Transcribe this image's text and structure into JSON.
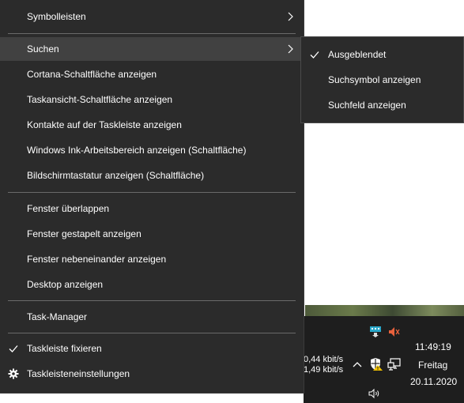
{
  "menu": {
    "items": [
      {
        "label": "Symbolleisten"
      },
      {
        "label": "Suchen"
      },
      {
        "label": "Cortana-Schaltfläche anzeigen"
      },
      {
        "label": "Taskansicht-Schaltfläche anzeigen"
      },
      {
        "label": "Kontakte auf der Taskleiste anzeigen"
      },
      {
        "label": "Windows Ink-Arbeitsbereich anzeigen (Schaltfläche)"
      },
      {
        "label": "Bildschirmtastatur anzeigen (Schaltfläche)"
      },
      {
        "label": "Fenster überlappen"
      },
      {
        "label": "Fenster gestapelt anzeigen"
      },
      {
        "label": "Fenster nebeneinander anzeigen"
      },
      {
        "label": "Desktop anzeigen"
      },
      {
        "label": "Task-Manager"
      },
      {
        "label": "Taskleiste fixieren"
      },
      {
        "label": "Taskleisteneinstellungen"
      }
    ]
  },
  "submenu": {
    "items": [
      {
        "label": "Ausgeblendet"
      },
      {
        "label": "Suchsymbol anzeigen"
      },
      {
        "label": "Suchfeld anzeigen"
      }
    ]
  },
  "tray": {
    "upload": "0,44 kbit/s",
    "download": "1,49 kbit/s",
    "time": "11:49:19",
    "weekday": "Freitag",
    "date": "20.11.2020"
  },
  "colors": {
    "menu_bg": "#2b2b2b",
    "hover_bg": "#414141",
    "separator": "#6a6a6a",
    "taskbar_bg": "#1e1e1e",
    "text": "#ffffff"
  },
  "icons": {
    "chevron": "chevron-right-icon",
    "check": "check-icon",
    "gear": "gear-icon"
  }
}
